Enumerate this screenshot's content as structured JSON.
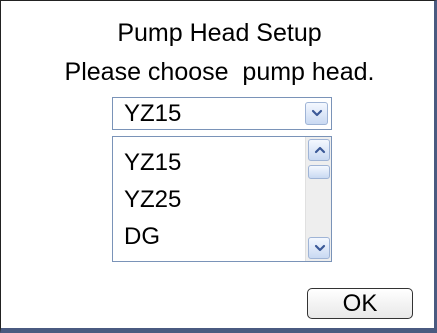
{
  "dialog": {
    "title": "Pump Head Setup",
    "prompt": "Please choose  pump head."
  },
  "combo": {
    "selected": "YZ15",
    "button_icon": "chevron-down-icon"
  },
  "list": {
    "items": [
      "YZ15",
      "YZ25",
      "DG"
    ],
    "scroll_up_icon": "chevron-up-icon",
    "scroll_down_icon": "chevron-down-icon"
  },
  "buttons": {
    "ok_label": "OK"
  },
  "colors": {
    "accent": "#4a5a80",
    "control_border": "#7a93b8",
    "chevron": "#3b5998"
  }
}
